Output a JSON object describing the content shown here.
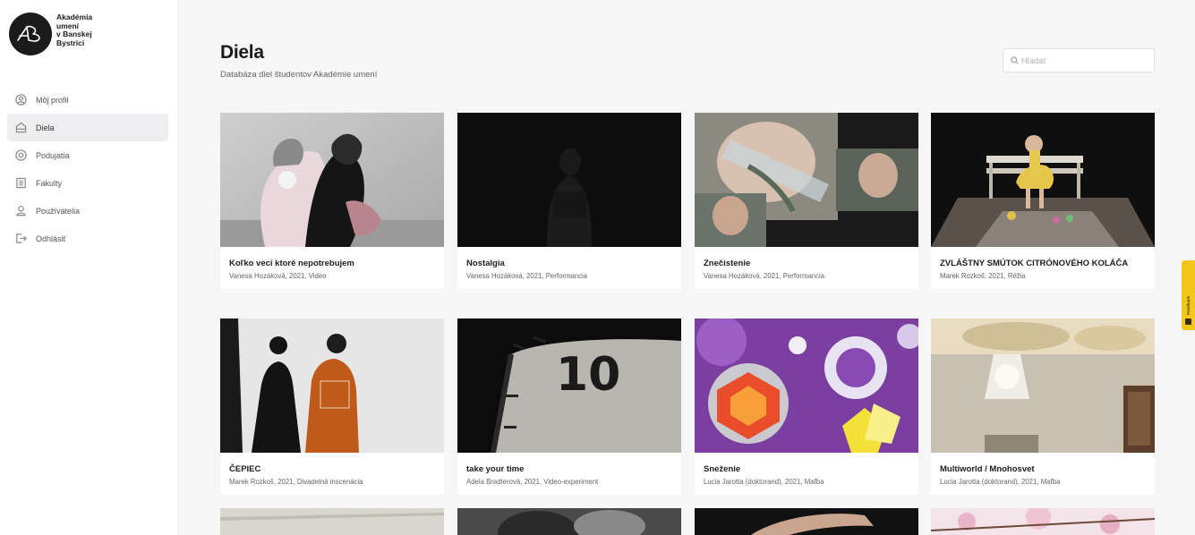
{
  "brand": {
    "name": "Akadémia\numení\nv Banskej\nBystrici",
    "logo_icon": "ab-monogram-logo"
  },
  "sidebar": {
    "items": [
      {
        "label": "Môj profil",
        "icon": "user-circle-icon",
        "active": false
      },
      {
        "label": "Diela",
        "icon": "artwork-frame-icon",
        "active": true
      },
      {
        "label": "Podujatia",
        "icon": "event-badge-icon",
        "active": false
      },
      {
        "label": "Fakulty",
        "icon": "building-icon",
        "active": false
      },
      {
        "label": "Používatelia",
        "icon": "users-icon",
        "active": false
      },
      {
        "label": "Odhlásiť",
        "icon": "logout-icon",
        "active": false
      }
    ]
  },
  "header": {
    "title": "Diela",
    "subtitle": "Databáza diel študentov Akadémie umení"
  },
  "search": {
    "placeholder": "Hľadať"
  },
  "works": [
    {
      "title": "Koľko vecí ktoré nepotrebujem",
      "meta": "Vanesa Hozáková, 2021, Video"
    },
    {
      "title": "Nostalgia",
      "meta": "Vanesa Hozáková, 2021, Performancia"
    },
    {
      "title": "Znečistenie",
      "meta": "Vanesa Hozáková, 2021, Performancia"
    },
    {
      "title": "ZVLÁŠTNY SMÚTOK CITRÓNOVÉHO KOLÁČA",
      "meta": "Marek Rozkoš, 2021, Réžia"
    },
    {
      "title": "ČEPIEC",
      "meta": "Marek Rozkoš, 2021, Divadelná inscenácia"
    },
    {
      "title": "take your time",
      "meta": "Adela Bradterová, 2021, Video-experiment"
    },
    {
      "title": "Sneženie",
      "meta": "Lucia Jarotta (doktorand), 2021, Maľba"
    },
    {
      "title": "Multiworld / Mnohosvet",
      "meta": "Lucia Jarotta (doktorand), 2021, Maľba"
    }
  ],
  "thumb_number_text": "10",
  "feedback": {
    "label": "Feedback"
  },
  "colors": {
    "accent": "#f3c61a",
    "active_nav": "#eeeef0"
  }
}
